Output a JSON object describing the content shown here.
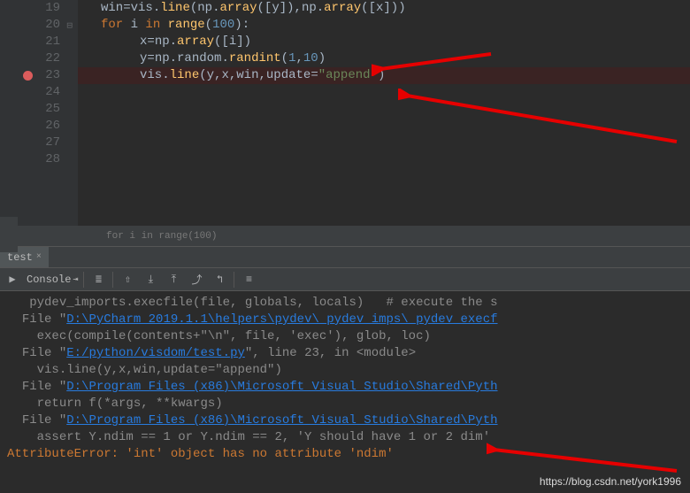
{
  "lines": [
    {
      "n": 19,
      "indent": 1,
      "tokens": [
        {
          "t": "win",
          "c": "id"
        },
        {
          "t": "=",
          "c": "op"
        },
        {
          "t": "vis",
          "c": "id"
        },
        {
          "t": ".",
          "c": "op"
        },
        {
          "t": "line",
          "c": "fn"
        },
        {
          "t": "(",
          "c": "paren"
        },
        {
          "t": "np",
          "c": "id"
        },
        {
          "t": ".",
          "c": "op"
        },
        {
          "t": "array",
          "c": "fn"
        },
        {
          "t": "(",
          "c": "paren"
        },
        {
          "t": "[",
          "c": "paren"
        },
        {
          "t": "y",
          "c": "id"
        },
        {
          "t": "]",
          "c": "paren"
        },
        {
          "t": ")",
          "c": "paren"
        },
        {
          "t": ",",
          "c": "op"
        },
        {
          "t": "np",
          "c": "id"
        },
        {
          "t": ".",
          "c": "op"
        },
        {
          "t": "array",
          "c": "fn"
        },
        {
          "t": "(",
          "c": "paren"
        },
        {
          "t": "[",
          "c": "paren"
        },
        {
          "t": "x",
          "c": "id"
        },
        {
          "t": "]",
          "c": "paren"
        },
        {
          "t": ")",
          "c": "paren"
        },
        {
          "t": ")",
          "c": "paren"
        }
      ]
    },
    {
      "n": 20,
      "indent": 1,
      "fold": true,
      "tokens": [
        {
          "t": "for ",
          "c": "kw"
        },
        {
          "t": "i ",
          "c": "id"
        },
        {
          "t": "in ",
          "c": "kw"
        },
        {
          "t": "range",
          "c": "fn"
        },
        {
          "t": "(",
          "c": "paren"
        },
        {
          "t": "100",
          "c": "num"
        },
        {
          "t": ")",
          "c": "paren"
        },
        {
          "t": ":",
          "c": "op"
        }
      ]
    },
    {
      "n": 21,
      "indent": 2,
      "tokens": [
        {
          "t": "x",
          "c": "id"
        },
        {
          "t": "=",
          "c": "op"
        },
        {
          "t": "np",
          "c": "id"
        },
        {
          "t": ".",
          "c": "op"
        },
        {
          "t": "array",
          "c": "fn"
        },
        {
          "t": "(",
          "c": "paren"
        },
        {
          "t": "[",
          "c": "paren"
        },
        {
          "t": "i",
          "c": "id"
        },
        {
          "t": "]",
          "c": "paren"
        },
        {
          "t": ")",
          "c": "paren"
        }
      ]
    },
    {
      "n": 22,
      "indent": 2,
      "tokens": [
        {
          "t": "y",
          "c": "id"
        },
        {
          "t": "=",
          "c": "op"
        },
        {
          "t": "np",
          "c": "id"
        },
        {
          "t": ".",
          "c": "op"
        },
        {
          "t": "random",
          "c": "id"
        },
        {
          "t": ".",
          "c": "op"
        },
        {
          "t": "randint",
          "c": "fn"
        },
        {
          "t": "(",
          "c": "paren"
        },
        {
          "t": "1",
          "c": "num"
        },
        {
          "t": ",",
          "c": "op"
        },
        {
          "t": "10",
          "c": "num"
        },
        {
          "t": ")",
          "c": "paren"
        }
      ]
    },
    {
      "n": 23,
      "indent": 2,
      "bp": true,
      "current": true,
      "tokens": [
        {
          "t": "vis",
          "c": "id"
        },
        {
          "t": ".",
          "c": "op"
        },
        {
          "t": "line",
          "c": "fn"
        },
        {
          "t": "(",
          "c": "paren"
        },
        {
          "t": "y",
          "c": "id"
        },
        {
          "t": ",",
          "c": "op"
        },
        {
          "t": "x",
          "c": "id"
        },
        {
          "t": ",",
          "c": "op"
        },
        {
          "t": "win",
          "c": "id"
        },
        {
          "t": ",",
          "c": "op"
        },
        {
          "t": "update",
          "c": "id"
        },
        {
          "t": "=",
          "c": "op"
        },
        {
          "t": "\"append\"",
          "c": "str"
        },
        {
          "t": ")",
          "c": "paren"
        }
      ]
    },
    {
      "n": 24,
      "indent": 0,
      "tokens": []
    },
    {
      "n": 25,
      "indent": 0,
      "tokens": []
    },
    {
      "n": 26,
      "indent": 0,
      "tokens": []
    },
    {
      "n": 27,
      "indent": 0,
      "tokens": []
    },
    {
      "n": 28,
      "indent": 0,
      "tokens": []
    }
  ],
  "breadcrumb": "for i in range(100)",
  "tab": {
    "label": "test",
    "close": "×"
  },
  "console_label": "Console",
  "toolbar_icons": [
    "▶",
    "≣",
    "⇧",
    "⤓",
    "⤒",
    "⤴",
    "↰",
    "≡"
  ],
  "output": [
    {
      "pre": "   ",
      "segs": [
        {
          "t": "pydev_imports.execfile(file, globals, locals)   # execute the s",
          "c": "co-dim"
        }
      ]
    },
    {
      "pre": "  ",
      "segs": [
        {
          "t": "File \"",
          "c": "co-dim"
        },
        {
          "t": "D:\\PyCharm 2019.1.1\\helpers\\pydev\\_pydev_imps\\_pydev_execf",
          "c": "co-link"
        }
      ]
    },
    {
      "pre": "    ",
      "segs": [
        {
          "t": "exec(compile(contents+\"\\n\", file, 'exec'), glob, loc)",
          "c": "co-dim"
        }
      ]
    },
    {
      "pre": "  ",
      "segs": [
        {
          "t": "File \"",
          "c": "co-dim"
        },
        {
          "t": "E:/python/visdom/test.py",
          "c": "co-link"
        },
        {
          "t": "\", line 23, in <module>",
          "c": "co-dim"
        }
      ]
    },
    {
      "pre": "    ",
      "segs": [
        {
          "t": "vis.line(y,x,win,update=\"append\")",
          "c": "co-dim"
        }
      ]
    },
    {
      "pre": "  ",
      "segs": [
        {
          "t": "File \"",
          "c": "co-dim"
        },
        {
          "t": "D:\\Program Files (x86)\\Microsoft Visual Studio\\Shared\\Pyth",
          "c": "co-link"
        }
      ]
    },
    {
      "pre": "    ",
      "segs": [
        {
          "t": "return f(*args, **kwargs)",
          "c": "co-dim"
        }
      ]
    },
    {
      "pre": "  ",
      "segs": [
        {
          "t": "File \"",
          "c": "co-dim"
        },
        {
          "t": "D:\\Program Files (x86)\\Microsoft Visual Studio\\Shared\\Pyth",
          "c": "co-link"
        }
      ]
    },
    {
      "pre": "    ",
      "segs": [
        {
          "t": "assert Y.ndim == 1 or Y.ndim == 2, 'Y should have 1 or 2 dim'",
          "c": "co-dim"
        }
      ]
    },
    {
      "pre": "",
      "segs": [
        {
          "t": "AttributeError: 'int' object has no attribute 'ndim'",
          "c": "co-err"
        }
      ]
    }
  ],
  "watermark": "https://blog.csdn.net/york1996"
}
